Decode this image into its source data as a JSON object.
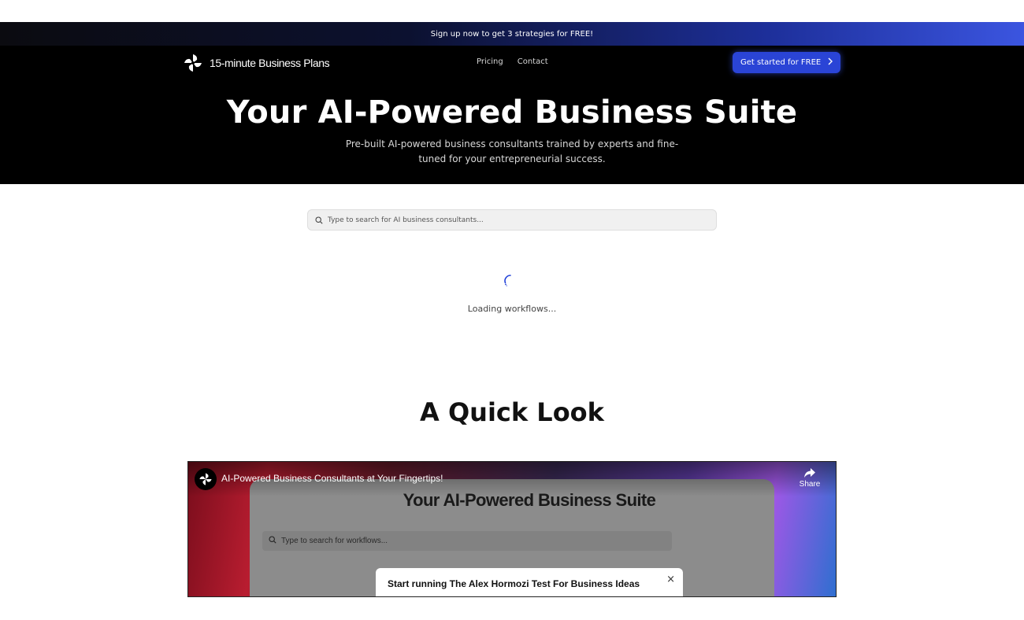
{
  "promo": {
    "text": "Sign up now to get 3 strategies for FREE!"
  },
  "nav": {
    "brand": "15-minute Business Plans",
    "links": [
      "Pricing",
      "Contact"
    ],
    "cta_label": "Get started for FREE"
  },
  "hero": {
    "title": "Your AI-Powered Business Suite",
    "subtitle": "Pre-built AI-powered business consultants trained by experts and fine-tuned for your entrepreneurial success."
  },
  "search": {
    "placeholder": "Type to search for AI business consultants..."
  },
  "loading": {
    "text": "Loading workflows..."
  },
  "quick_look": {
    "title": "A Quick Look",
    "video": {
      "title": "AI-Powered Business Consultants at Your Fingertips!",
      "share_label": "Share",
      "preview_title": "Your AI-Powered Business Suite",
      "preview_search_placeholder": "Type to search for workflows...",
      "modal_title": "Start running The Alex Hormozi Test For Business Ideas",
      "modal_close": "×"
    }
  },
  "colors": {
    "accent": "#2a44d6",
    "spinner": "#1f3fd8",
    "hero_bg": "#000000"
  },
  "icons": {
    "brand": "pinwheel-logo-icon",
    "cta": "chevron-right-icon",
    "search": "search-icon",
    "share": "share-arrow-icon"
  }
}
